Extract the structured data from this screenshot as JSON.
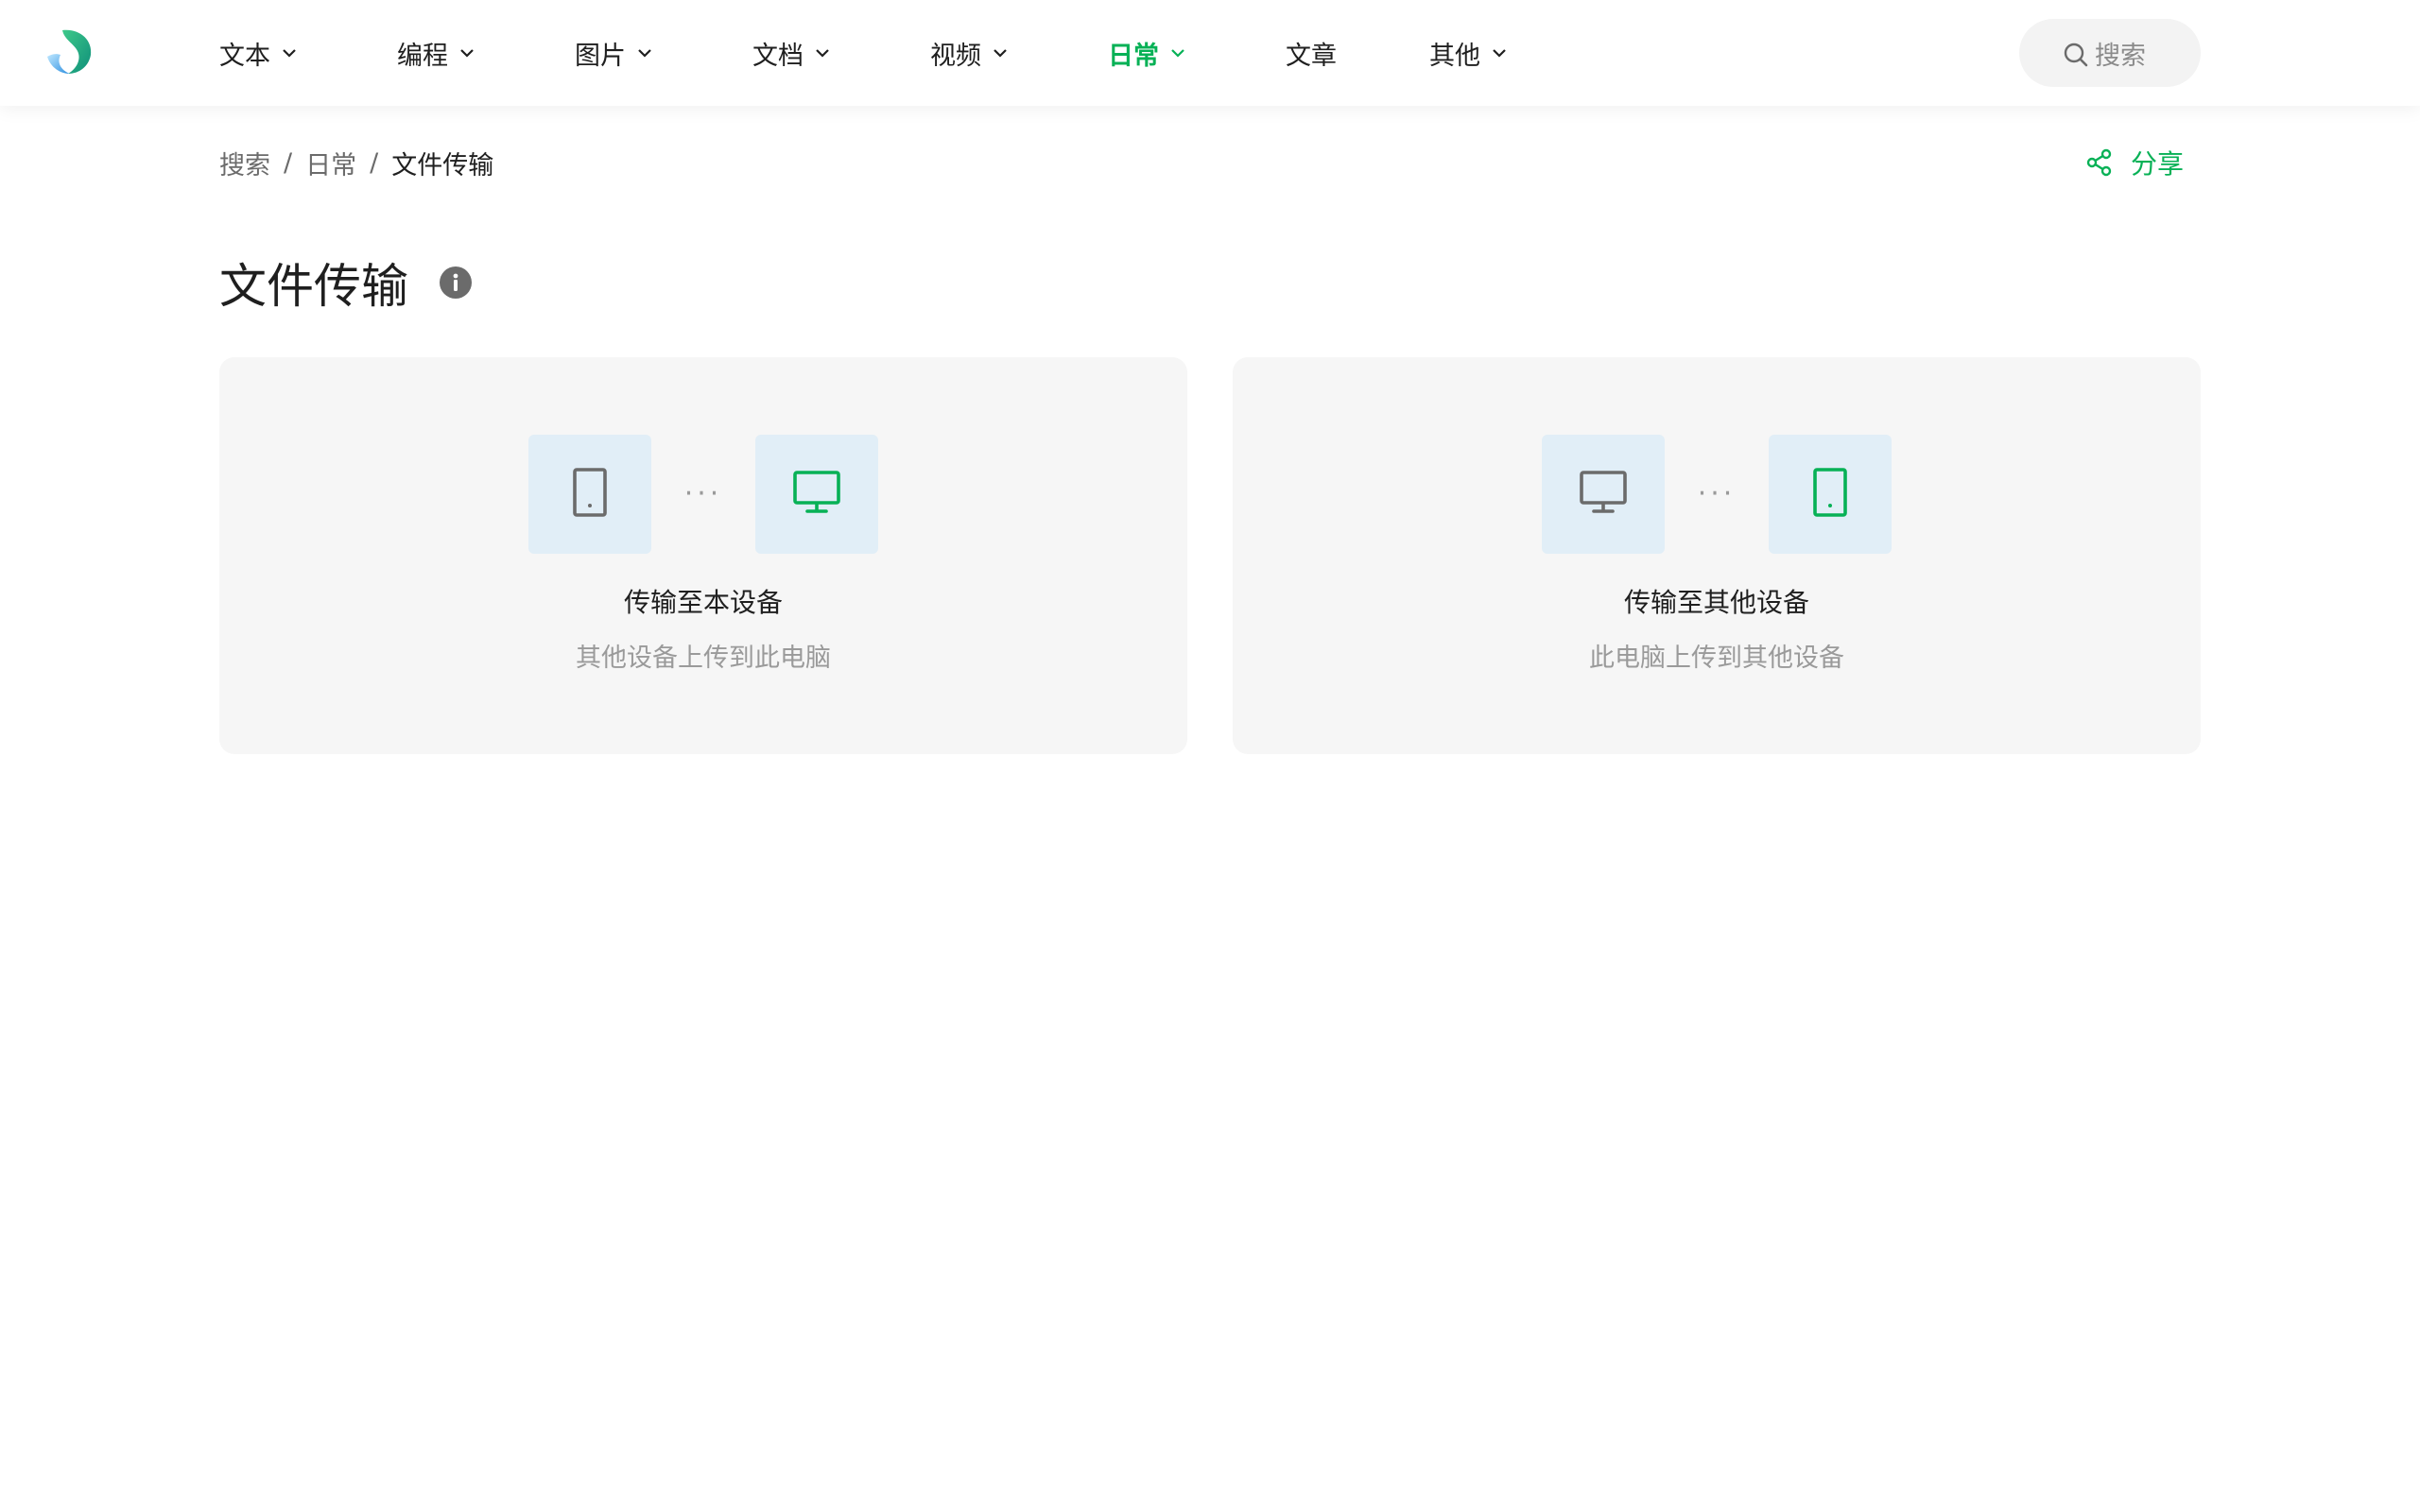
{
  "colors": {
    "accent": "#07b156",
    "icon_gray": "#6b6b6b",
    "device_box_bg": "#e1eef7",
    "card_bg": "#f6f6f6"
  },
  "header": {
    "nav": [
      {
        "label": "文本",
        "has_dropdown": true
      },
      {
        "label": "编程",
        "has_dropdown": true
      },
      {
        "label": "图片",
        "has_dropdown": true
      },
      {
        "label": "文档",
        "has_dropdown": true
      },
      {
        "label": "视频",
        "has_dropdown": true
      },
      {
        "label": "日常",
        "has_dropdown": true,
        "active": true
      },
      {
        "label": "文章",
        "has_dropdown": false
      },
      {
        "label": "其他",
        "has_dropdown": true
      }
    ],
    "search_placeholder": "搜索"
  },
  "breadcrumb": {
    "items": [
      "搜索",
      "日常",
      "文件传输"
    ],
    "separator": "/"
  },
  "share_label": "分享",
  "page_title": "文件传输",
  "cards": [
    {
      "title": "传输至本设备",
      "description": "其他设备上传到此电脑",
      "from_icon": "phone-icon",
      "to_icon": "monitor-icon",
      "dots": "···"
    },
    {
      "title": "传输至其他设备",
      "description": "此电脑上传到其他设备",
      "from_icon": "monitor-icon",
      "to_icon": "phone-icon",
      "dots": "···"
    }
  ]
}
